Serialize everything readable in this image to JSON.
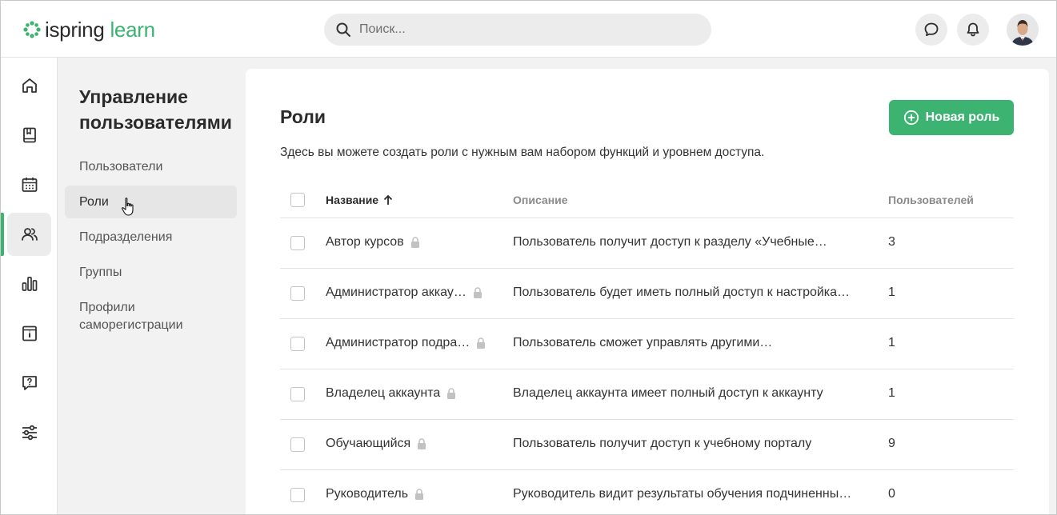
{
  "header": {
    "logo": {
      "part1": "ispring",
      "part2": "learn"
    },
    "search": {
      "placeholder": "Поиск..."
    },
    "icons": [
      "chat-icon",
      "bell-icon"
    ],
    "brand_color": "#3cb371"
  },
  "rail": {
    "items": [
      "home-icon",
      "book-icon",
      "calendar-icon",
      "users-icon",
      "chart-icon",
      "info-icon",
      "help-icon",
      "settings-icon"
    ],
    "active": "users-icon"
  },
  "subnav": {
    "title": "Управление пользователями",
    "items": [
      {
        "label": "Пользователи"
      },
      {
        "label": "Роли"
      },
      {
        "label": "Подразделения"
      },
      {
        "label": "Группы"
      },
      {
        "label": "Профили саморегистрации"
      }
    ],
    "active": "Роли"
  },
  "main": {
    "title": "Роли",
    "description": "Здесь вы можете создать роли с нужным вам набором функций и уровнем доступа.",
    "new_button": "Новая роль",
    "table": {
      "columns": [
        "Название",
        "Описание",
        "Пользователей"
      ],
      "sort": "Название ascending",
      "rows": [
        {
          "name": "Автор курсов",
          "desc": "Пользователь получит доступ к разделу «Учебные…",
          "count": "3"
        },
        {
          "name": "Администратор аккау…",
          "desc": "Пользователь будет иметь полный доступ к настройка…",
          "count": "1"
        },
        {
          "name": "Администратор подра…",
          "desc": "Пользователь сможет управлять другими…",
          "count": "1"
        },
        {
          "name": "Владелец аккаунта",
          "desc": "Владелец аккаунта имеет полный доступ к аккаунту",
          "count": "1"
        },
        {
          "name": "Обучающийся",
          "desc": "Пользователь получит доступ к учебному порталу",
          "count": "9"
        },
        {
          "name": "Руководитель",
          "desc": "Руководитель видит результаты обучения подчиненны…",
          "count": "0"
        }
      ]
    }
  }
}
